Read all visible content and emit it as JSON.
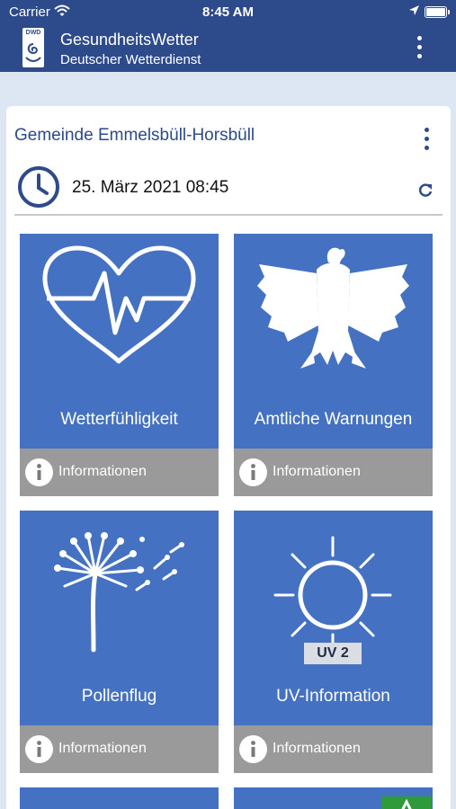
{
  "status_bar": {
    "carrier": "Carrier",
    "time": "8:45 AM"
  },
  "header": {
    "logo_text": "DWD",
    "title": "GesundheitsWetter",
    "subtitle": "Deutscher Wetterdienst"
  },
  "location": {
    "name": "Gemeinde Emmelsbüll-Horsbüll",
    "datetime": "25. März 2021 08:45"
  },
  "tiles": [
    {
      "label": "Wetterfühligkeit",
      "info_label": "Informationen",
      "icon": "heart-pulse-icon"
    },
    {
      "label": "Amtliche Warnungen",
      "info_label": "Informationen",
      "icon": "federal-eagle-icon"
    },
    {
      "label": "Pollenflug",
      "info_label": "Informationen",
      "icon": "dandelion-icon"
    },
    {
      "label": "UV-Information",
      "info_label": "Informationen",
      "icon": "sun-icon",
      "uv_badge": "UV 2"
    }
  ],
  "colors": {
    "header": "#2d4a8a",
    "tile": "#4471c1",
    "info_bar": "#9a9a9a",
    "background": "#dde6f3"
  }
}
